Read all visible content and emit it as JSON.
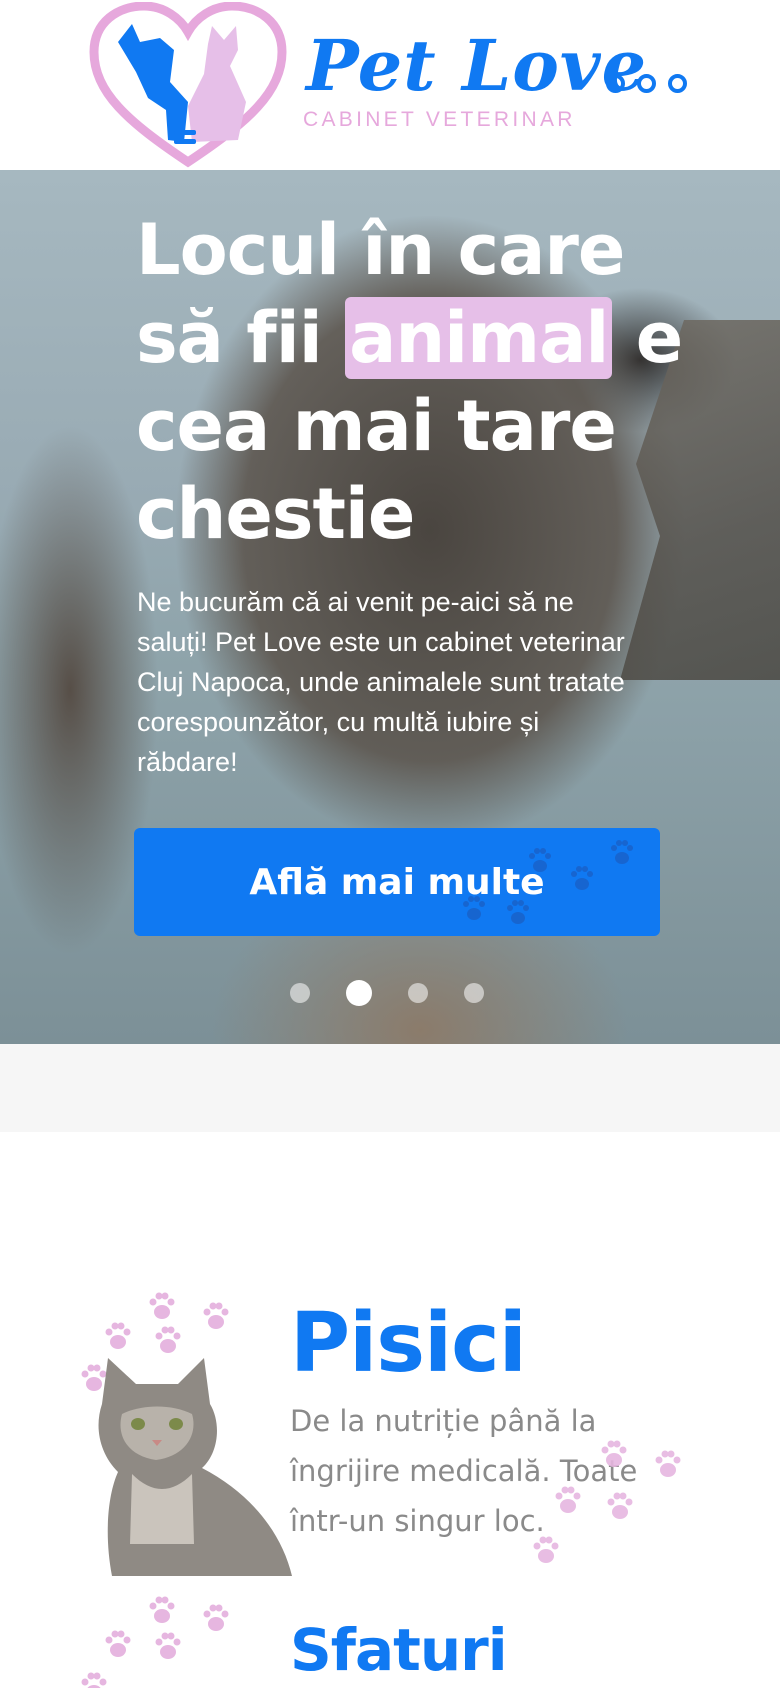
{
  "header": {
    "brand_name": "Pet Love",
    "brand_subtitle": "CABINET VETERINAR",
    "menu_icon": "more-dots-icon"
  },
  "hero": {
    "title_before": "Locul în care să fii ",
    "title_highlight": "animal",
    "title_after": " e cea mai tare chestie",
    "description": "Ne bucurăm că ai venit pe-aici să ne saluți! Pet Love este un cabinet veterinar Cluj Napoca, unde animalele sunt tratate corespounzător, cu multă iubire și răbdare!",
    "cta_label": "Află mai multe",
    "slides_count": 4,
    "active_slide": 2
  },
  "services": [
    {
      "title": "Pisici",
      "description": "De la nutriție până la îngrijire medicală. Toate într-un singur loc."
    },
    {
      "title": "Sfaturi"
    }
  ],
  "colors": {
    "brand_blue": "#1079f2",
    "brand_pink": "#e6a8dc",
    "highlight_pink": "#e6bfe8",
    "muted_text": "#8a8a8a"
  }
}
